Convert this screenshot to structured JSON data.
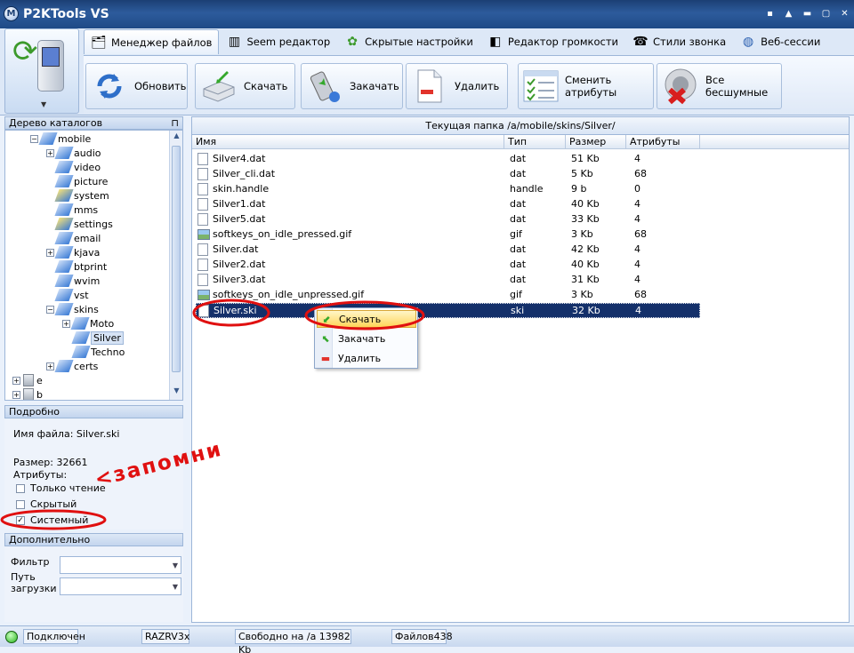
{
  "window": {
    "title": "P2KTools VS",
    "logo": "M"
  },
  "tabs": [
    {
      "label": "Менеджер файлов",
      "icon": "file-manager-icon"
    },
    {
      "label": "Seem редактор",
      "icon": "seem-editor-icon"
    },
    {
      "label": "Скрытые настройки",
      "icon": "gear-icon"
    },
    {
      "label": "Редактор громкости",
      "icon": "volume-icon"
    },
    {
      "label": "Стили звонка",
      "icon": "ring-style-icon"
    },
    {
      "label": "Веб-сессии",
      "icon": "globe-icon"
    }
  ],
  "toolbar": {
    "refresh": "Обновить",
    "download": "Скачать",
    "upload": "Закачать",
    "delete": "Удалить",
    "change_attrs": "Сменить атрибуты",
    "all_silent": "Все бесшумные"
  },
  "tree": {
    "header": "Дерево каталогов",
    "nodes": [
      {
        "label": "mobile"
      },
      {
        "label": "audio"
      },
      {
        "label": "video"
      },
      {
        "label": "picture"
      },
      {
        "label": "system"
      },
      {
        "label": "mms"
      },
      {
        "label": "settings"
      },
      {
        "label": "email"
      },
      {
        "label": "kjava"
      },
      {
        "label": "btprint"
      },
      {
        "label": "wvim"
      },
      {
        "label": "vst"
      },
      {
        "label": "skins"
      },
      {
        "label": "Moto"
      },
      {
        "label": "Silver"
      },
      {
        "label": "Techno"
      },
      {
        "label": "certs"
      },
      {
        "label": "e"
      },
      {
        "label": "b"
      }
    ]
  },
  "details": {
    "header": "Подробно",
    "filename_label": "Имя файла: Silver.ski",
    "size_label": "Размер: 32661",
    "attrs_label": "Атрибуты:",
    "readonly": "Только чтение",
    "hidden": "Скрытый",
    "system": "Системный",
    "system_checked": true
  },
  "extra": {
    "header": "Дополнительно",
    "filter_label": "Фильтр",
    "path_label_1": "Путь",
    "path_label_2": "загрузки"
  },
  "files": {
    "current_path": "Текущая папка /a/mobile/skins/Silver/",
    "columns": [
      "Имя",
      "Тип",
      "Размер",
      "Атрибуты"
    ],
    "rows": [
      {
        "name": "Silver4.dat",
        "type": "dat",
        "size": "51 Kb",
        "attr": "4",
        "icon": "file"
      },
      {
        "name": "Silver_cli.dat",
        "type": "dat",
        "size": "5 Kb",
        "attr": "68",
        "icon": "file"
      },
      {
        "name": "skin.handle",
        "type": "handle",
        "size": "9 b",
        "attr": "0",
        "icon": "file"
      },
      {
        "name": "Silver1.dat",
        "type": "dat",
        "size": "40 Kb",
        "attr": "4",
        "icon": "file"
      },
      {
        "name": "Silver5.dat",
        "type": "dat",
        "size": "33 Kb",
        "attr": "4",
        "icon": "file"
      },
      {
        "name": "softkeys_on_idle_pressed.gif",
        "type": "gif",
        "size": "3 Kb",
        "attr": "68",
        "icon": "gif"
      },
      {
        "name": "Silver.dat",
        "type": "dat",
        "size": "42 Kb",
        "attr": "4",
        "icon": "file"
      },
      {
        "name": "Silver2.dat",
        "type": "dat",
        "size": "40 Kb",
        "attr": "4",
        "icon": "file"
      },
      {
        "name": "Silver3.dat",
        "type": "dat",
        "size": "31 Kb",
        "attr": "4",
        "icon": "file"
      },
      {
        "name": "softkeys_on_idle_unpressed.gif",
        "type": "gif",
        "size": "3 Kb",
        "attr": "68",
        "icon": "gif"
      },
      {
        "name": "Silver.ski",
        "type": "ski",
        "size": "32 Kb",
        "attr": "4",
        "icon": "file",
        "selected": true
      }
    ]
  },
  "context_menu": {
    "items": [
      "Скачать",
      "Закачать",
      "Удалить"
    ]
  },
  "status": {
    "connected": "Подключен",
    "model": "RAZRV3x",
    "free": "Свободно на /a 13982 Kb",
    "files": "Файлов438"
  },
  "annotation": {
    "text": "<запомни"
  },
  "colors": {
    "accent": "#14306a",
    "annotation": "#e01010",
    "title_bar": "#2d5b9c"
  }
}
